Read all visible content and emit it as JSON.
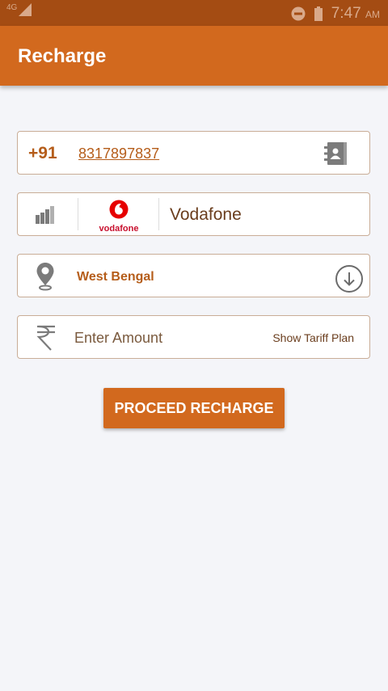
{
  "status_bar": {
    "network": "4G",
    "time": "7:47",
    "ampm": "AM",
    "icons": [
      "signal-icon",
      "dnd-icon",
      "battery-icon"
    ]
  },
  "app_bar": {
    "title": "Recharge"
  },
  "mobile_field": {
    "country_code": "+91",
    "number": "8317897837",
    "icon": "contacts-book-icon"
  },
  "operator_field": {
    "icon": "signal-bars-icon",
    "logo_text": "vodafone",
    "operator_name": "Vodafone"
  },
  "circle_field": {
    "icon": "location-pin-icon",
    "state": "West Bengal",
    "dropdown_icon": "circle-down-arrow-icon"
  },
  "amount_field": {
    "icon": "rupee-icon",
    "placeholder": "Enter Amount",
    "value": "",
    "tariff_link": "Show Tariff Plan"
  },
  "proceed_button": {
    "label": "PROCEED RECHARGE"
  },
  "colors": {
    "status_bar": "#a44c13",
    "app_bar": "#d2691e",
    "accent_text": "#b55d1a",
    "background": "#f4f5f9",
    "field_border": "#c9ad97",
    "vodafone_red": "#e60000"
  }
}
